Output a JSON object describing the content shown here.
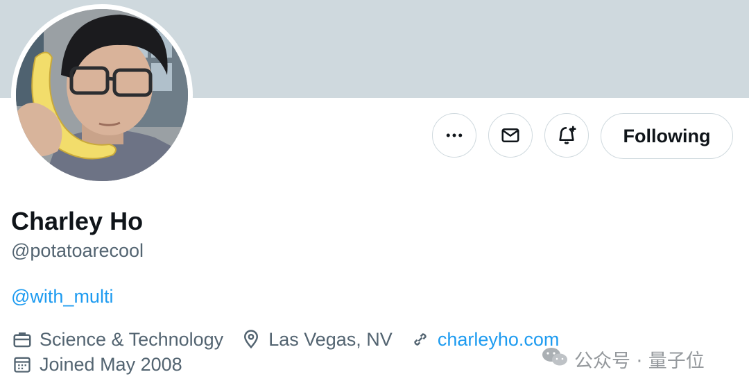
{
  "profile": {
    "name": "Charley Ho",
    "handle": "@potatoarecool",
    "bio_mention": "@with_multi",
    "category": "Science & Technology",
    "location": "Las Vegas, NV",
    "website": "charleyho.com",
    "joined": "Joined May 2008"
  },
  "actions": {
    "more_icon": "more-horizontal-icon",
    "message_icon": "envelope-icon",
    "notify_icon": "bell-plus-icon",
    "follow_label": "Following"
  },
  "icons": {
    "category": "briefcase-icon",
    "location": "map-pin-icon",
    "website": "link-icon",
    "joined": "calendar-icon"
  },
  "watermark": {
    "text": "公众号 · 量子位",
    "icon": "wechat-icon"
  },
  "colors": {
    "banner": "#cfd9de",
    "link": "#1d9bf0",
    "secondary_text": "#536471",
    "primary_text": "#0f1419",
    "border": "#cfd9de"
  }
}
